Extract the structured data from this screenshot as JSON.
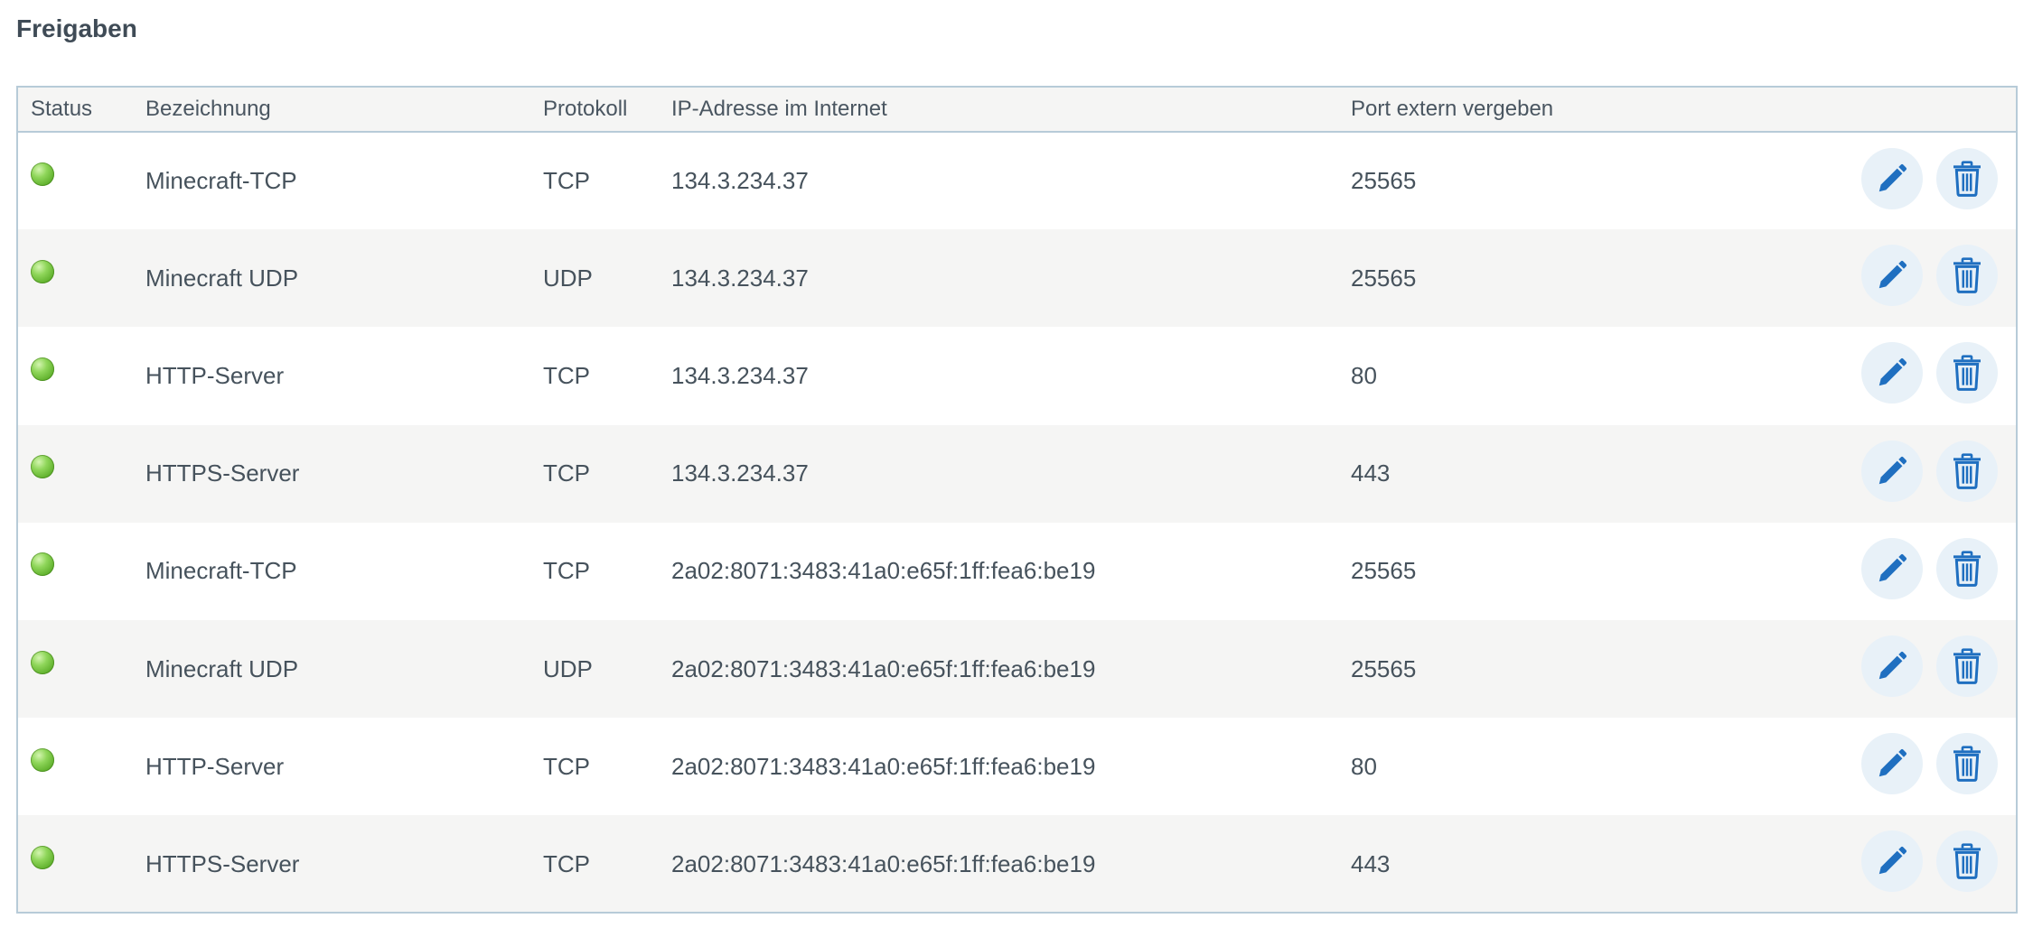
{
  "title": "Freigaben",
  "columns": {
    "status": "Status",
    "name": "Bezeichnung",
    "protocol": "Protokoll",
    "ip": "IP-Adresse im Internet",
    "port": "Port extern vergeben"
  },
  "rows": [
    {
      "status": "active",
      "name": "Minecraft-TCP",
      "protocol": "TCP",
      "ip": "134.3.234.37",
      "port": "25565"
    },
    {
      "status": "active",
      "name": "Minecraft UDP",
      "protocol": "UDP",
      "ip": "134.3.234.37",
      "port": "25565"
    },
    {
      "status": "active",
      "name": "HTTP-Server",
      "protocol": "TCP",
      "ip": "134.3.234.37",
      "port": "80"
    },
    {
      "status": "active",
      "name": "HTTPS-Server",
      "protocol": "TCP",
      "ip": "134.3.234.37",
      "port": "443"
    },
    {
      "status": "active",
      "name": "Minecraft-TCP",
      "protocol": "TCP",
      "ip": "2a02:8071:3483:41a0:e65f:1ff:fea6:be19",
      "port": "25565"
    },
    {
      "status": "active",
      "name": "Minecraft UDP",
      "protocol": "UDP",
      "ip": "2a02:8071:3483:41a0:e65f:1ff:fea6:be19",
      "port": "25565"
    },
    {
      "status": "active",
      "name": "HTTP-Server",
      "protocol": "TCP",
      "ip": "2a02:8071:3483:41a0:e65f:1ff:fea6:be19",
      "port": "80"
    },
    {
      "status": "active",
      "name": "HTTPS-Server",
      "protocol": "TCP",
      "ip": "2a02:8071:3483:41a0:e65f:1ff:fea6:be19",
      "port": "443"
    }
  ],
  "icons": {
    "status": "green-led-icon",
    "edit": "pencil-icon",
    "delete": "trash-icon"
  },
  "colors": {
    "accent": "#1f6fc0",
    "action_bg": "#e8f1f8",
    "status_active": "#6cc23a",
    "border": "#b7cbd8",
    "stripe": "#f5f5f4"
  }
}
